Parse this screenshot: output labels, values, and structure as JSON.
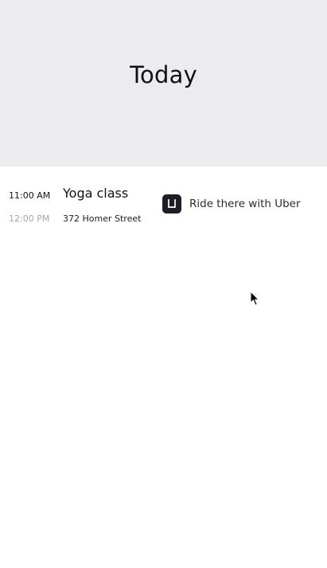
{
  "header": {
    "title": "Today"
  },
  "event": {
    "start_time": "11:00 AM",
    "end_time": "12:00 PM",
    "title": "Yoga class",
    "location": "372 Homer Street"
  },
  "ride_button": {
    "label": "Ride there with Uber",
    "icon": "uber-logo-icon"
  },
  "colors": {
    "header_background": "#ececee",
    "muted_time": "#a6a6a6",
    "uber_icon_background": "#1d1e24"
  }
}
